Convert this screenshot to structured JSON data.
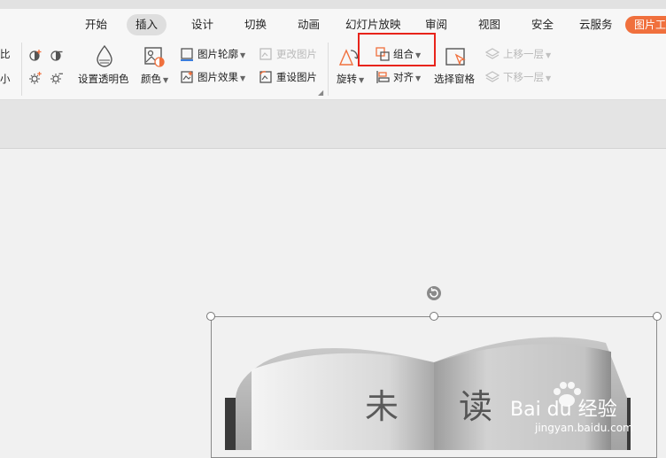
{
  "tabs": [
    "开始",
    "插入",
    "设计",
    "切换",
    "动画",
    "幻灯片放映",
    "审阅",
    "视图",
    "安全",
    "云服务",
    "图片工"
  ],
  "active_tab": "插入",
  "ribbon": {
    "left_partial_top": "比",
    "left_partial_bottom": "小",
    "set_transparent": "设置透明色",
    "color": "颜色",
    "outline": "图片轮廓",
    "effects": "图片效果",
    "change_picture": "更改图片",
    "reset_picture": "重设图片",
    "rotate": "旋转",
    "group": "组合",
    "align": "对齐",
    "select_pane": "选择窗格",
    "bring_forward": "上移一层",
    "send_backward": "下移一层"
  },
  "book": {
    "char_left": "未",
    "char_right": "读"
  },
  "watermark": {
    "brand": "Bai du 经验",
    "url": "jingyan.baidu.com"
  },
  "colors": {
    "accent": "#f0703d",
    "highlight": "#e8241b"
  }
}
